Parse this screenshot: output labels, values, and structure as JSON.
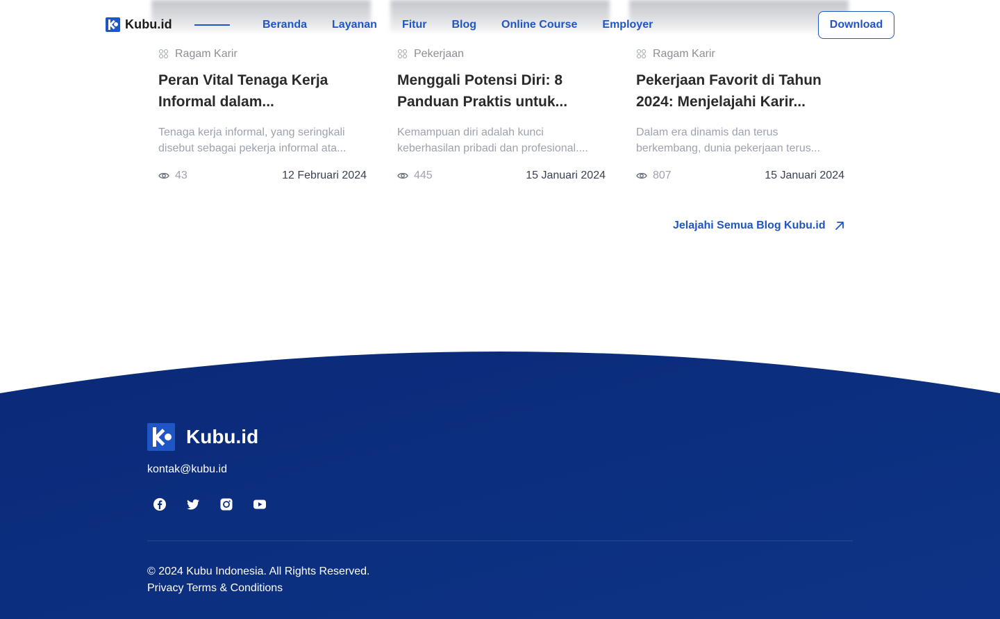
{
  "header": {
    "logo_text": "Kubu.id",
    "nav": [
      "Beranda",
      "Layanan",
      "Fitur",
      "Blog",
      "Online Course",
      "Employer"
    ],
    "download_label": "Download"
  },
  "cards": [
    {
      "category": "Ragam Karir",
      "title": "Peran Vital Tenaga Kerja Informal dalam...",
      "excerpt": "Tenaga kerja informal, yang seringkali disebut sebagai pekerja informal ata...",
      "views": "43",
      "date": "12 Februari 2024"
    },
    {
      "category": "Pekerjaan",
      "title": "Menggali Potensi Diri: 8 Panduan Praktis untuk...",
      "excerpt": "Kemampuan diri adalah kunci keberhasilan pribadi dan profesional....",
      "views": "445",
      "date": "15 Januari 2024"
    },
    {
      "category": "Ragam Karir",
      "title": "Pekerjaan Favorit di Tahun 2024: Menjelajahi Karir...",
      "excerpt": "Dalam era dinamis dan terus berkembang, dunia pekerjaan terus...",
      "views": "807",
      "date": "15 Januari 2024"
    }
  ],
  "explore_label": "Jelajahi Semua Blog Kubu.id",
  "footer": {
    "logo_text": "Kubu.id",
    "email": "kontak@kubu.id",
    "socials": [
      "facebook-icon",
      "twitter-icon",
      "instagram-icon",
      "youtube-icon"
    ],
    "copyright": "© 2024 Kubu Indonesia. All Rights Reserved.",
    "privacy_label": "Privacy",
    "terms_label": "Terms & Conditions"
  },
  "colors": {
    "brand_blue": "#1f55c4",
    "footer_navy": "#0a2a78"
  }
}
